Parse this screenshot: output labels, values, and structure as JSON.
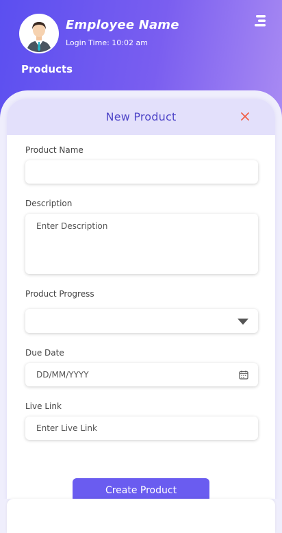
{
  "header": {
    "employee_name": "Employee Name",
    "login_time": "Login Time: 10:02 am",
    "section_title": "Products",
    "menu_icon": "menu-icon",
    "avatar_icon": "avatar"
  },
  "form": {
    "title": "New Product",
    "close_icon": "close-icon",
    "fields": {
      "product_name_label": "Product Name",
      "product_name_value": "",
      "description_label": "Description",
      "description_placeholder": "Enter Description",
      "progress_label": "Product Progress",
      "progress_value": "",
      "due_date_label": "Due Date",
      "due_date_placeholder": "DD/MM/YYYY",
      "live_link_label": "Live Link",
      "live_link_placeholder": "Enter Live Link"
    },
    "submit_label": "Create Product"
  },
  "colors": {
    "brand": "#6a5cf0",
    "header_gradient_start": "#5b4ff0",
    "header_gradient_end": "#a98bf3",
    "close": "#f0604a"
  }
}
